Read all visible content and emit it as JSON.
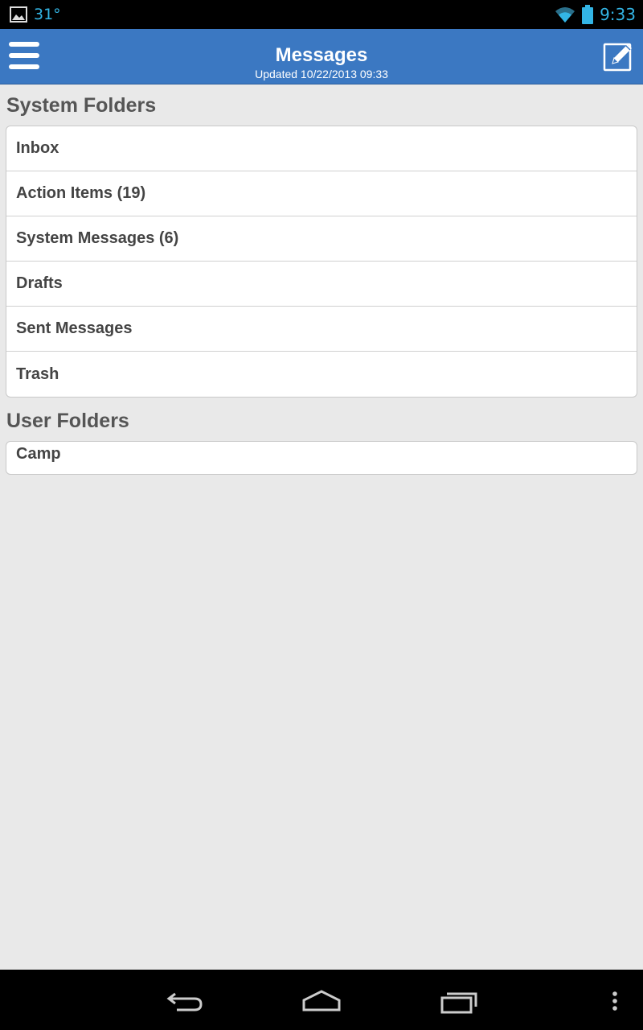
{
  "statusbar": {
    "temperature": "31°",
    "time": "9:33",
    "icons": [
      "image-icon",
      "wifi-icon",
      "battery-icon"
    ]
  },
  "header": {
    "title": "Messages",
    "subtitle": "Updated 10/22/2013 09:33",
    "color": "#3b78c2",
    "icons": [
      "menu-icon",
      "compose-icon"
    ]
  },
  "system_folders": {
    "title": "System Folders",
    "items": [
      {
        "label": "Inbox"
      },
      {
        "label": "Action Items (19)"
      },
      {
        "label": "System Messages (6)"
      },
      {
        "label": "Drafts"
      },
      {
        "label": "Sent Messages"
      },
      {
        "label": "Trash"
      }
    ]
  },
  "user_folders": {
    "title": "User Folders",
    "items": [
      {
        "label": "Camp"
      }
    ]
  },
  "navbar": {
    "icons": [
      "back-icon",
      "home-icon",
      "recent-apps-icon",
      "overflow-menu-icon"
    ]
  }
}
